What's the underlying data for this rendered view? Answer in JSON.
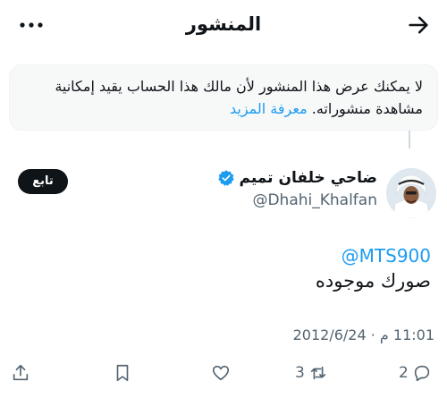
{
  "header": {
    "title": "المنشور",
    "back_icon": "arrow-right-icon",
    "more_icon": "more-horizontal-icon"
  },
  "notice": {
    "text": "لا يمكنك عرض هذا المنشور لأن مالك هذا الحساب يقيد إمكانية مشاهدة منشوراته.",
    "link_label": "معرفة المزيد"
  },
  "author": {
    "display_name": "ضاحي خلفان تميم",
    "handle": "@Dhahi_Khalfan",
    "verified_icon": "verified-badge-icon",
    "follow_label": "تابع"
  },
  "tweet": {
    "mention": "@MTS900",
    "text": "صورك موجوده",
    "timestamp": "11:01 م · 2012/6/24"
  },
  "actions": {
    "reply_count": "2",
    "retweet_count": "3",
    "like_count": "",
    "icons": [
      "reply-icon",
      "retweet-icon",
      "like-icon",
      "bookmark-icon",
      "share-icon"
    ]
  },
  "colors": {
    "accent": "#1d9bf0",
    "verified": "#1d9bf0",
    "text": "#0f1419",
    "muted": "#536471",
    "notice_bg": "#f7f9f9"
  }
}
